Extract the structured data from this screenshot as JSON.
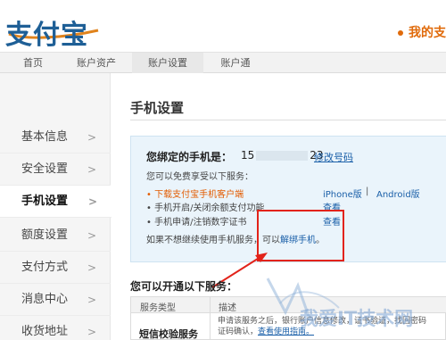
{
  "header": {
    "logo": "支付宝",
    "my_alipay": "我的支"
  },
  "nav": {
    "items": [
      "首页",
      "账户资产",
      "账户设置",
      "账户通"
    ],
    "active_index": 2
  },
  "sidebar": {
    "items": [
      "基本信息",
      "安全设置",
      "手机设置",
      "额度设置",
      "支付方式",
      "消息中心",
      "收货地址"
    ],
    "active_index": 2
  },
  "main": {
    "title": "手机设置",
    "bound_label": "您绑定的手机是：",
    "bound_num_prefix": "15",
    "bound_num_suffix": "23",
    "change_password": "修改号码",
    "free_services_text": "您可以免费享受以下服务：",
    "services": [
      {
        "text": "• 下载支付宝手机客户端",
        "orange": true,
        "links": [
          "iPhone版",
          "Android版"
        ],
        "separator": "|"
      },
      {
        "text": "• 手机开启/关闭余额支付功能",
        "orange": false,
        "links": [
          "查看"
        ]
      },
      {
        "text": "• 手机申请/注销数字证书",
        "orange": false,
        "links": [
          "查看"
        ]
      }
    ],
    "unbind_prefix": "如果不想继续使用手机服务，可以",
    "unbind_link": "解绑手机",
    "unbind_suffix": "。",
    "open_title": "您可以开通以下服务：",
    "table": {
      "headers": [
        "服务类型",
        "描述"
      ],
      "row_name": "短信校验服务",
      "row_desc_1": "申请该服务之后，银行账户信息修改，证书验证，找回密码",
      "row_desc_2": "证码确认，",
      "row_desc_link": "查看使用指南。"
    }
  },
  "watermark": "我爱IT技术网",
  "colors": {
    "accent_orange": "#e35b00",
    "link_blue": "#1a5fa8",
    "highlight_red": "#e2231a"
  }
}
